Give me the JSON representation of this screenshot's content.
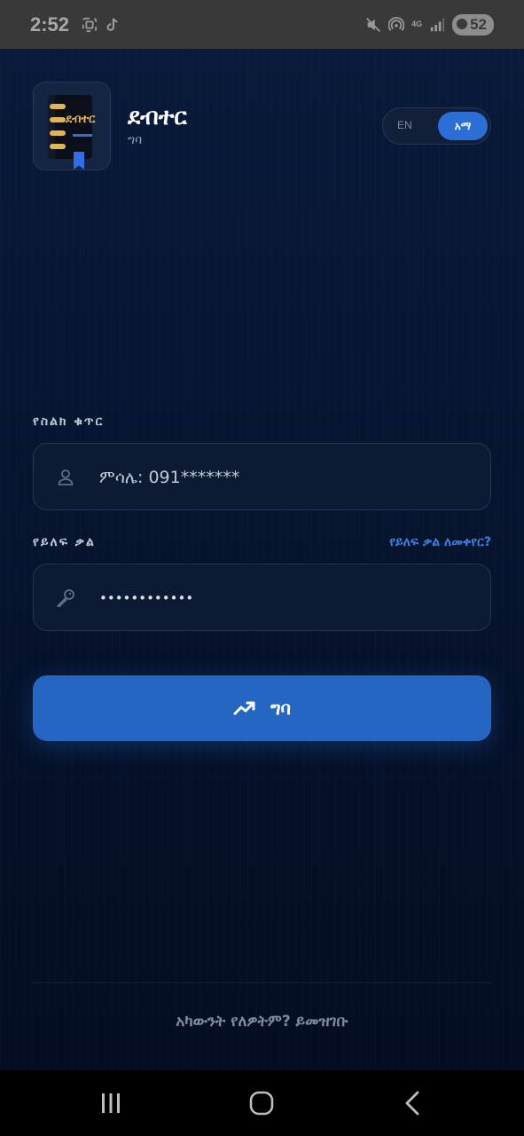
{
  "status_bar": {
    "time": "2:52",
    "network": "4G",
    "battery": "52"
  },
  "app": {
    "title": "ደብተር",
    "subtitle": "ግባ",
    "logo_text": "ደብተር"
  },
  "language_toggle": {
    "options": [
      "EN",
      "አማ"
    ],
    "selected": "አማ"
  },
  "form": {
    "phone_label": "የስልክ ቁጥር",
    "phone_placeholder": "ምሳሌ: 091*******",
    "password_label": "የይለፍ ቃል",
    "forgot_password": "የይለፍ ቃል ለመቀየር?",
    "password_value": "••••••••••••",
    "login_button": "ግባ"
  },
  "footer": {
    "register_prompt": "አካውንት የለዎትም? ይመዝገቡ"
  },
  "icons": {
    "user": "user-icon",
    "key": "key-icon",
    "login": "trending-up-icon"
  },
  "colors": {
    "accent": "#2466c2",
    "background": "#06122b",
    "link": "#3b80e0"
  }
}
